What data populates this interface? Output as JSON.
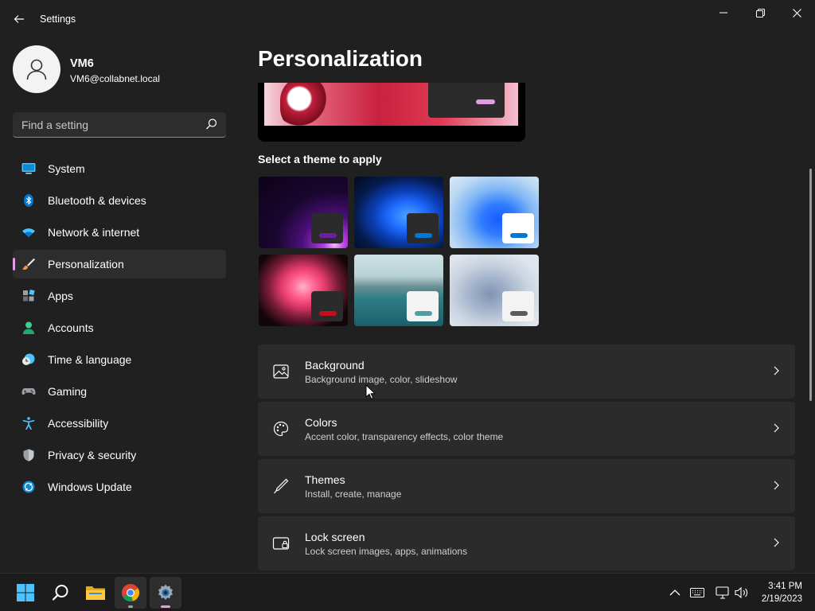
{
  "window": {
    "app_title": "Settings",
    "minimize_glyph": "—",
    "maximize_glyph": "❐",
    "close_glyph": "✕",
    "back_glyph": "←"
  },
  "profile": {
    "name": "VM6",
    "email": "VM6@collabnet.local"
  },
  "search": {
    "placeholder": "Find a setting"
  },
  "nav": {
    "items": [
      {
        "label": "System",
        "icon": "monitor-icon"
      },
      {
        "label": "Bluetooth & devices",
        "icon": "bluetooth-icon"
      },
      {
        "label": "Network & internet",
        "icon": "wifi-icon"
      },
      {
        "label": "Personalization",
        "icon": "brush-icon",
        "selected": true
      },
      {
        "label": "Apps",
        "icon": "apps-icon"
      },
      {
        "label": "Accounts",
        "icon": "person-icon"
      },
      {
        "label": "Time & language",
        "icon": "clock-globe-icon"
      },
      {
        "label": "Gaming",
        "icon": "gamepad-icon"
      },
      {
        "label": "Accessibility",
        "icon": "accessibility-icon"
      },
      {
        "label": "Privacy & security",
        "icon": "shield-icon"
      },
      {
        "label": "Windows Update",
        "icon": "update-icon"
      }
    ]
  },
  "page": {
    "title": "Personalization",
    "theme_section_label": "Select a theme to apply"
  },
  "themes": [
    {
      "icon": "theme-glow-dark",
      "accent": "#6b1fa0",
      "mini_bg": "#2b2b2b"
    },
    {
      "icon": "theme-bloom-dark",
      "accent": "#0078d4",
      "mini_bg": "#2b2b2b"
    },
    {
      "icon": "theme-bloom-light",
      "accent": "#0078d4",
      "mini_bg": "#ffffff"
    },
    {
      "icon": "theme-captured-motion",
      "accent": "#c50f1f",
      "mini_bg": "#2b2b2b"
    },
    {
      "icon": "theme-lake",
      "accent": "#4f9da6",
      "mini_bg": "#f3f3f3"
    },
    {
      "icon": "theme-flow",
      "accent": "#5b5b5b",
      "mini_bg": "#f3f3f3"
    }
  ],
  "cards": [
    {
      "title": "Background",
      "subtitle": "Background image, color, slideshow",
      "icon": "image-icon"
    },
    {
      "title": "Colors",
      "subtitle": "Accent color, transparency effects, color theme",
      "icon": "palette-icon"
    },
    {
      "title": "Themes",
      "subtitle": "Install, create, manage",
      "icon": "pen-icon"
    },
    {
      "title": "Lock screen",
      "subtitle": "Lock screen images, apps, animations",
      "icon": "lock-screen-icon"
    }
  ],
  "taskbar": {
    "time": "3:41 PM",
    "date": "2/19/2023"
  },
  "colors": {
    "accent": "#e19ce6",
    "background": "#202020",
    "card": "#2b2b2b"
  }
}
